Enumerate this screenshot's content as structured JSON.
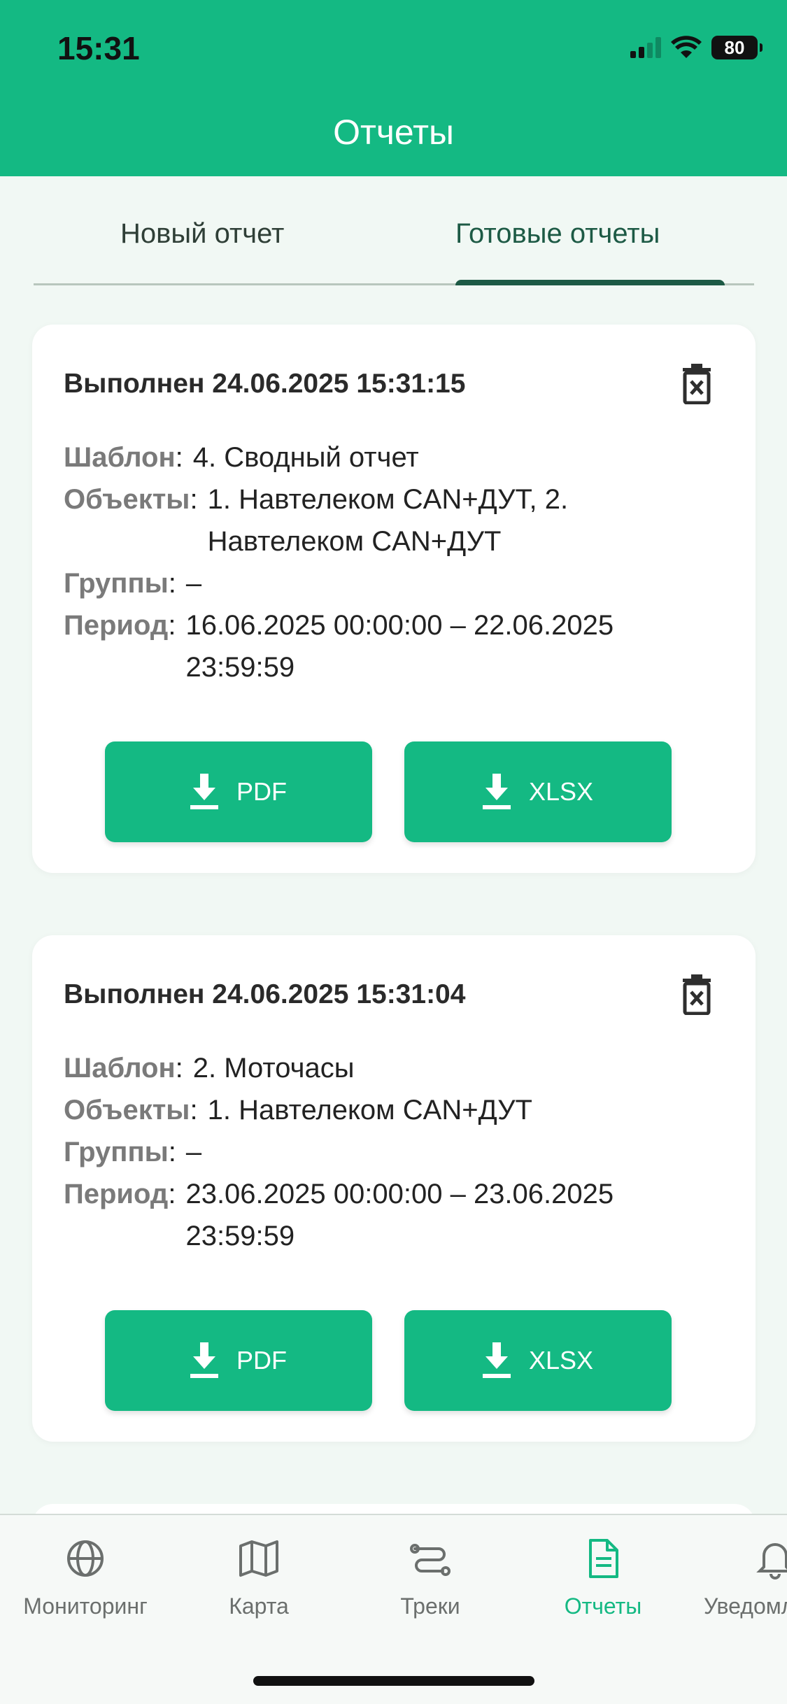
{
  "status": {
    "time": "15:31",
    "battery": "80"
  },
  "header": {
    "title": "Отчеты"
  },
  "tabs": [
    {
      "label": "Новый отчет",
      "active": false
    },
    {
      "label": "Готовые отчеты",
      "active": true
    }
  ],
  "reports": [
    {
      "title": "Выполнен 24.06.2025 15:31:15",
      "template_label": "Шаблон",
      "template_value": "4. Сводный отчет",
      "objects_label": "Объекты",
      "objects_value": "1. Навтелеком CAN+ДУТ, 2. Навтелеком CAN+ДУТ",
      "groups_label": "Группы",
      "groups_value": "–",
      "period_label": "Период",
      "period_value": "16.06.2025 00:00:00 – 22.06.2025 23:59:59",
      "pdf_label": "PDF",
      "xlsx_label": "XLSX"
    },
    {
      "title": "Выполнен 24.06.2025 15:31:04",
      "template_label": "Шаблон",
      "template_value": "2. Моточасы",
      "objects_label": "Объекты",
      "objects_value": "1. Навтелеком CAN+ДУТ",
      "groups_label": "Группы",
      "groups_value": "–",
      "period_label": "Период",
      "period_value": "23.06.2025 00:00:00 – 23.06.2025 23:59:59",
      "pdf_label": "PDF",
      "xlsx_label": "XLSX"
    }
  ],
  "nav": [
    {
      "label": "Мониторинг",
      "icon": "globe-icon"
    },
    {
      "label": "Карта",
      "icon": "map-icon"
    },
    {
      "label": "Треки",
      "icon": "route-icon"
    },
    {
      "label": "Отчеты",
      "icon": "document-icon",
      "active": true
    },
    {
      "label": "Уведомл",
      "icon": "bell-icon"
    }
  ],
  "colors": {
    "accent": "#14b983",
    "tab_active": "#1d5a45",
    "background": "#f1f8f4"
  }
}
